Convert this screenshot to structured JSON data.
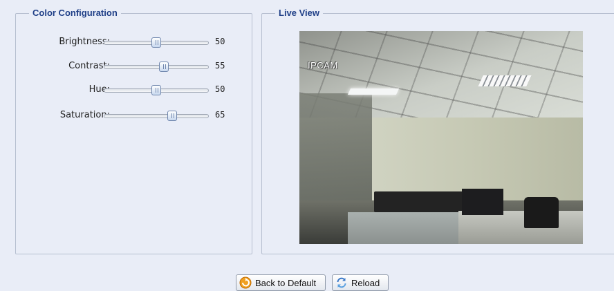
{
  "color_config": {
    "title": "Color Configuration",
    "sliders": [
      {
        "label": "Brightness:",
        "value": "50",
        "fraction": 0.5
      },
      {
        "label": "Contrast:",
        "value": "55",
        "fraction": 0.57
      },
      {
        "label": "Hue:",
        "value": "50",
        "fraction": 0.5
      },
      {
        "label": "Saturation:",
        "value": "65",
        "fraction": 0.65
      }
    ]
  },
  "live_view": {
    "title": "Live View",
    "camera_overlay": "IPCAM"
  },
  "buttons": {
    "back_to_default": "Back to Default",
    "reload": "Reload"
  },
  "icons": {
    "back_to_default": "undo-arrow-icon",
    "reload": "refresh-icon"
  },
  "colors": {
    "legend": "#1f3f87",
    "background": "#e9edf7",
    "border": "#b6bfd0"
  }
}
